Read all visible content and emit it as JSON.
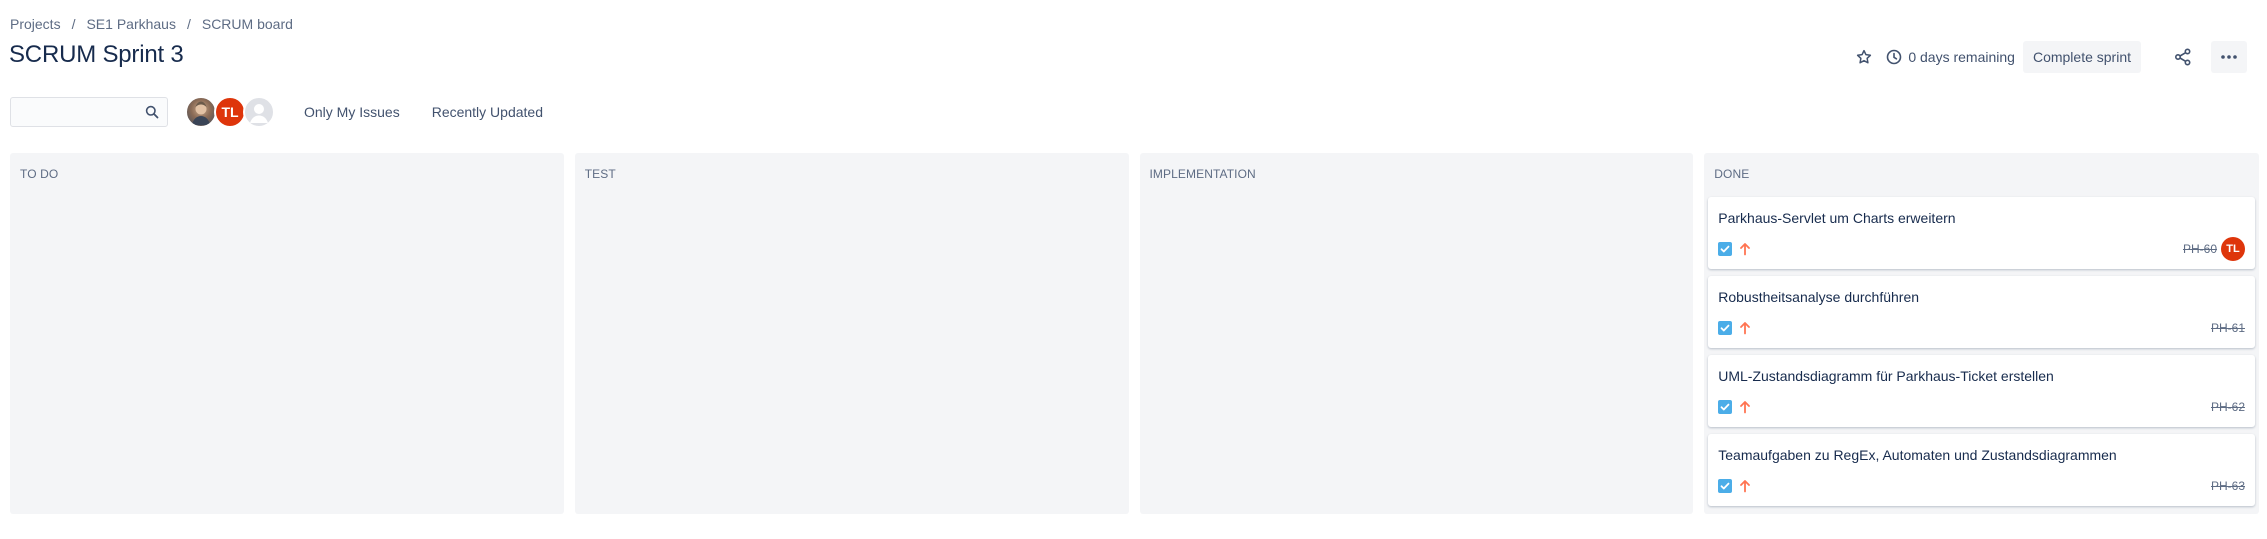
{
  "breadcrumbs": [
    "Projects",
    "SE1 Parkhaus",
    "SCRUM board"
  ],
  "page_title": "SCRUM Sprint 3",
  "header": {
    "remaining": "0 days remaining",
    "complete_sprint": "Complete sprint",
    "star_icon": "star-icon",
    "clock_icon": "clock-icon",
    "share_icon": "share-icon",
    "more_icon": "more-icon"
  },
  "toolbar": {
    "search_value": "",
    "avatars": [
      {
        "type": "photo",
        "initials": ""
      },
      {
        "type": "initials",
        "initials": "TL"
      },
      {
        "type": "default",
        "initials": ""
      }
    ],
    "filters": [
      "Only My Issues",
      "Recently Updated"
    ]
  },
  "columns": [
    {
      "title": "TO DO",
      "cards": []
    },
    {
      "title": "TEST",
      "cards": []
    },
    {
      "title": "IMPLEMENTATION",
      "cards": []
    },
    {
      "title": "DONE",
      "cards": [
        {
          "summary": "Parkhaus-Servlet um Charts erweitern",
          "key": "PH-60",
          "assignee": "TL"
        },
        {
          "summary": "Robustheitsanalyse durchführen",
          "key": "PH-61",
          "assignee": ""
        },
        {
          "summary": "UML-Zustandsdiagramm für Parkhaus-Ticket erstellen",
          "key": "PH-62",
          "assignee": ""
        },
        {
          "summary": "Teamaufgaben zu RegEx, Automaten und Zustandsdiagrammen",
          "key": "PH-63",
          "assignee": ""
        }
      ]
    }
  ],
  "colors": {
    "task_icon": "#4bade8",
    "priority_high": "#ff7452",
    "avatar_red": "#de350b",
    "column_bg": "#f4f5f7"
  }
}
